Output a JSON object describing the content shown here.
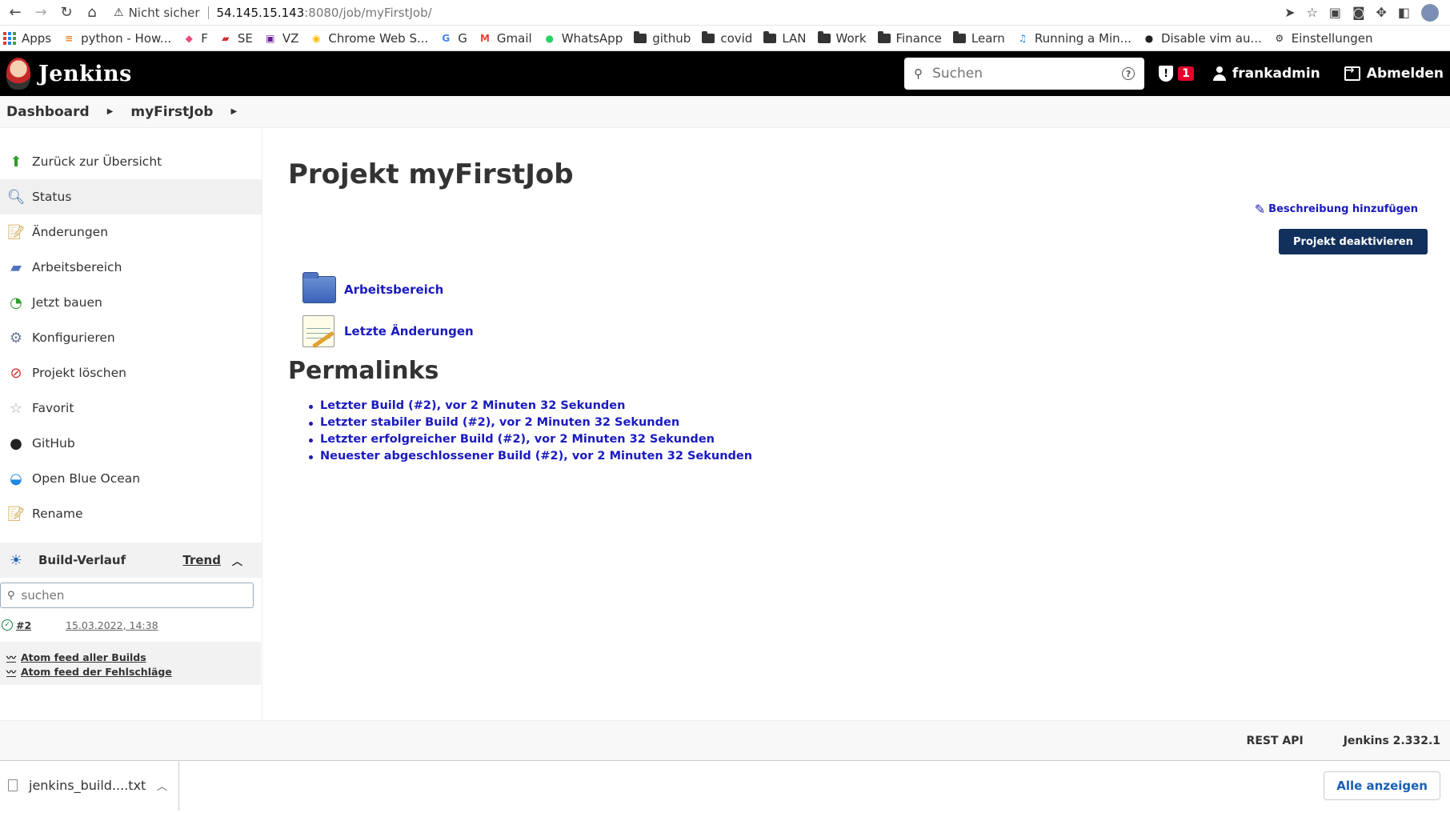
{
  "browser": {
    "insecure_label": "Nicht sicher",
    "url_host": "54.145.15.143",
    "url_path": ":8080/job/myFirstJob/",
    "bookmarks": [
      {
        "label": "Apps",
        "icon": "apps-grid-icon"
      },
      {
        "label": "python - How...",
        "icon": "stackoverflow-icon"
      },
      {
        "label": "F",
        "icon": "f-icon"
      },
      {
        "label": "SE",
        "icon": "se-icon"
      },
      {
        "label": "VZ",
        "icon": "vz-icon"
      },
      {
        "label": "Chrome Web S...",
        "icon": "chrome-webstore-icon"
      },
      {
        "label": "G",
        "icon": "google-icon"
      },
      {
        "label": "Gmail",
        "icon": "gmail-icon"
      },
      {
        "label": "WhatsApp",
        "icon": "whatsapp-icon"
      },
      {
        "label": "github",
        "icon": "folder-icon"
      },
      {
        "label": "covid",
        "icon": "folder-icon"
      },
      {
        "label": "LAN",
        "icon": "folder-icon"
      },
      {
        "label": "Work",
        "icon": "folder-icon"
      },
      {
        "label": "Finance",
        "icon": "folder-icon"
      },
      {
        "label": "Learn",
        "icon": "folder-icon"
      },
      {
        "label": "Running a Min...",
        "icon": "music-icon"
      },
      {
        "label": "Disable vim au...",
        "icon": "github-icon"
      },
      {
        "label": "Einstellungen",
        "icon": "gear-icon"
      }
    ]
  },
  "header": {
    "logo_text": "Jenkins",
    "search_placeholder": "Suchen",
    "alert_count": "1",
    "user": "frankadmin",
    "logout": "Abmelden"
  },
  "breadcrumb": {
    "items": [
      "Dashboard",
      "myFirstJob"
    ]
  },
  "sidebar": {
    "items": [
      {
        "label": "Zurück zur Übersicht",
        "icon": "up-arrow-icon"
      },
      {
        "label": "Status",
        "icon": "magnifier-icon"
      },
      {
        "label": "Änderungen",
        "icon": "notepad-icon"
      },
      {
        "label": "Arbeitsbereich",
        "icon": "folder-icon"
      },
      {
        "label": "Jetzt bauen",
        "icon": "build-clock-icon"
      },
      {
        "label": "Konfigurieren",
        "icon": "gear-icon"
      },
      {
        "label": "Projekt löschen",
        "icon": "no-entry-icon"
      },
      {
        "label": "Favorit",
        "icon": "star-icon"
      },
      {
        "label": "GitHub",
        "icon": "github-icon"
      },
      {
        "label": "Open Blue Ocean",
        "icon": "blue-ocean-icon"
      },
      {
        "label": "Rename",
        "icon": "notepad-icon"
      }
    ]
  },
  "build_history": {
    "title": "Build-Verlauf",
    "trend": "Trend",
    "search_placeholder": "suchen",
    "builds": [
      {
        "number": "#2",
        "date": "15.03.2022, 14:38",
        "status": "success"
      }
    ],
    "feeds": [
      "Atom feed aller Builds",
      "Atom feed der Fehlschläge"
    ]
  },
  "content": {
    "title": "Projekt myFirstJob",
    "add_description": "Beschreibung hinzufügen",
    "deactivate": "Projekt deaktivieren",
    "workspace_link": "Arbeitsbereich",
    "changes_link": "Letzte Änderungen",
    "permalinks_title": "Permalinks",
    "permalinks": [
      "Letzter Build (#2), vor 2 Minuten 32 Sekunden",
      "Letzter stabiler Build (#2), vor 2 Minuten 32 Sekunden",
      "Letzter erfolgreicher Build (#2), vor 2 Minuten 32 Sekunden",
      "Neuester abgeschlossener Build (#2), vor 2 Minuten 32 Sekunden"
    ]
  },
  "footer": {
    "rest_api": "REST API",
    "version": "Jenkins 2.332.1"
  },
  "downloads": {
    "file": "jenkins_build....txt",
    "show_all": "Alle anzeigen"
  },
  "colors": {
    "header_bg": "#000000",
    "link": "#1a1ac0",
    "primary_button": "#11305b",
    "alert_badge": "#e4002b"
  }
}
